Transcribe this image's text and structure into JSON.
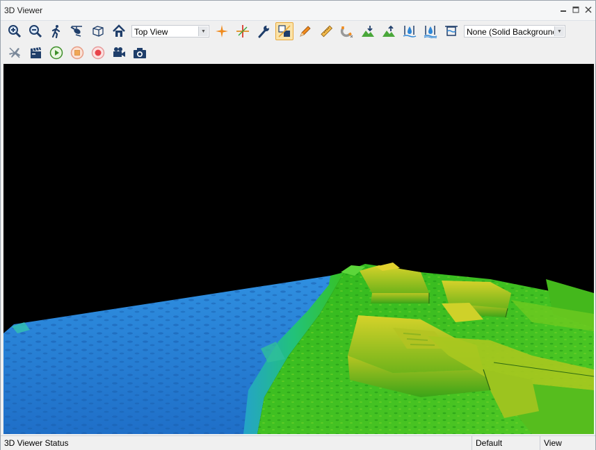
{
  "window": {
    "title": "3D Viewer"
  },
  "toolbar": {
    "view_select": {
      "value": "Top View"
    },
    "background_select": {
      "value": "None (Solid Background"
    }
  },
  "status": {
    "main": "3D Viewer Status",
    "profile": "Default",
    "mode": "View"
  },
  "colors": {
    "accent_orange": "#f08a1c",
    "icon_navy": "#1f3e6a",
    "active_tool_bg": "#fbe3a8",
    "water_blue": "#2e86d6",
    "terrain_green": "#3cc21c",
    "terrain_yellow": "#d9d02a"
  }
}
